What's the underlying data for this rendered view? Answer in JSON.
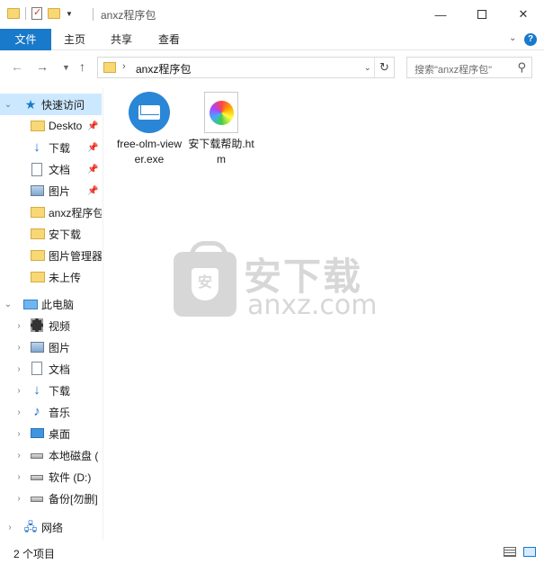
{
  "window": {
    "title": "anxz程序包"
  },
  "ribbon": {
    "tabs": [
      {
        "label": "文件"
      },
      {
        "label": "主页"
      },
      {
        "label": "共享"
      },
      {
        "label": "查看"
      }
    ]
  },
  "address": {
    "separator": "›",
    "crumb": "anxz程序包",
    "search_placeholder": "搜索\"anxz程序包\""
  },
  "nav": {
    "quick_access": {
      "label": "快速访问",
      "items": [
        {
          "label": "Deskto",
          "icon": "folder-icon",
          "pinned": true
        },
        {
          "label": "下载",
          "icon": "download-icon",
          "pinned": true
        },
        {
          "label": "文档",
          "icon": "document-icon",
          "pinned": true
        },
        {
          "label": "图片",
          "icon": "picture-icon",
          "pinned": true
        },
        {
          "label": "anxz程序包",
          "icon": "folder-icon",
          "pinned": false
        },
        {
          "label": "安下载",
          "icon": "folder-icon",
          "pinned": false
        },
        {
          "label": "图片管理器",
          "icon": "folder-icon",
          "pinned": false
        },
        {
          "label": "未上传",
          "icon": "folder-icon",
          "pinned": false
        }
      ]
    },
    "this_pc": {
      "label": "此电脑",
      "items": [
        {
          "label": "视频",
          "icon": "video-icon"
        },
        {
          "label": "图片",
          "icon": "picture-icon"
        },
        {
          "label": "文档",
          "icon": "document-icon"
        },
        {
          "label": "下载",
          "icon": "download-icon"
        },
        {
          "label": "音乐",
          "icon": "music-icon"
        },
        {
          "label": "桌面",
          "icon": "desktop-icon"
        },
        {
          "label": "本地磁盘 (",
          "icon": "drive-icon"
        },
        {
          "label": "软件 (D:)",
          "icon": "drive-icon"
        },
        {
          "label": "备份[勿删]",
          "icon": "drive-icon"
        }
      ]
    },
    "network": {
      "label": "网络"
    }
  },
  "files": [
    {
      "name": "free-olm-viewer.exe",
      "icon": "mail-app-icon"
    },
    {
      "name": "安下载帮助.htm",
      "icon": "htm-file-icon"
    }
  ],
  "watermark": {
    "text_cn": "安下载",
    "text_en": "anxz.com",
    "badge": "安"
  },
  "status": {
    "item_count": "2 个项目"
  }
}
